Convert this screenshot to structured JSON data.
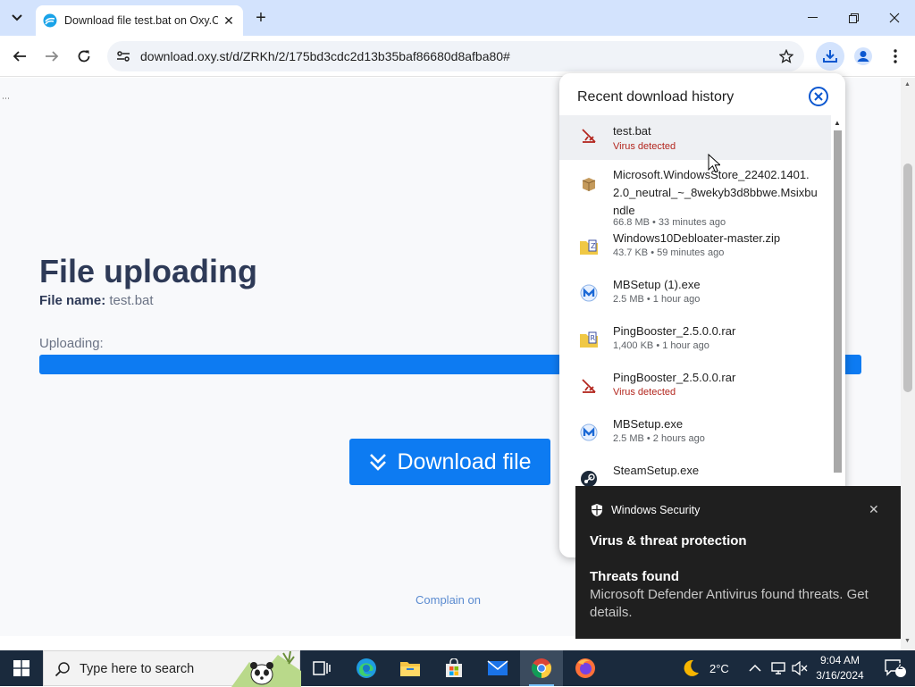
{
  "browser": {
    "tab": {
      "title": "Download file test.bat on Oxy.C",
      "favicon": "oxy-favicon-icon"
    },
    "url": "download.oxy.st/d/ZRKh/2/175bd3cdc2d13b35baf86680d8afba80#",
    "colors": {
      "tabbar": "#d3e3fd",
      "accent": "#0b57d0"
    }
  },
  "page": {
    "title": "File uploading",
    "file_name_label": "File name:",
    "file_name_value": "test.bat",
    "uploading_label": "Uploading:",
    "progress_percent": 100,
    "download_button": "Download file",
    "complain_link": "Complain on",
    "colors": {
      "primary": "#0d7bf2",
      "heading": "#2e3a57"
    }
  },
  "downloads_panel": {
    "title": "Recent download history",
    "items": [
      {
        "name": "test.bat",
        "status": "Virus detected",
        "icon": "blocked-file-icon",
        "danger": true
      },
      {
        "name": "Microsoft.WindowsStore_22402.1401.2.0_neutral_~_8wekyb3d8bbwe.Msixbundle",
        "status": "66.8 MB • 33 minutes ago",
        "icon": "package-icon",
        "danger": false
      },
      {
        "name": "Windows10Debloater-master.zip",
        "status": "43.7 KB • 59 minutes ago",
        "icon": "zip-archive-icon",
        "danger": false
      },
      {
        "name": "MBSetup (1).exe",
        "status": "2.5 MB • 1 hour ago",
        "icon": "malwarebytes-icon",
        "danger": false
      },
      {
        "name": "PingBooster_2.5.0.0.rar",
        "status": "1,400 KB • 1 hour ago",
        "icon": "rar-archive-icon",
        "danger": false
      },
      {
        "name": "PingBooster_2.5.0.0.rar",
        "status": "Virus detected",
        "icon": "blocked-file-icon",
        "danger": true
      },
      {
        "name": "MBSetup.exe",
        "status": "2.5 MB • 2 hours ago",
        "icon": "malwarebytes-icon",
        "danger": false
      },
      {
        "name": "SteamSetup.exe",
        "status": "",
        "icon": "steam-icon",
        "danger": false
      }
    ]
  },
  "toast": {
    "app": "Windows Security",
    "heading": "Virus & threat protection",
    "subheading": "Threats found",
    "body": "Microsoft Defender Antivirus found threats. Get details."
  },
  "taskbar": {
    "search_placeholder": "Type here to search",
    "weather": "2°C",
    "time": "9:04 AM",
    "date": "3/16/2024",
    "notification_count": "2"
  }
}
